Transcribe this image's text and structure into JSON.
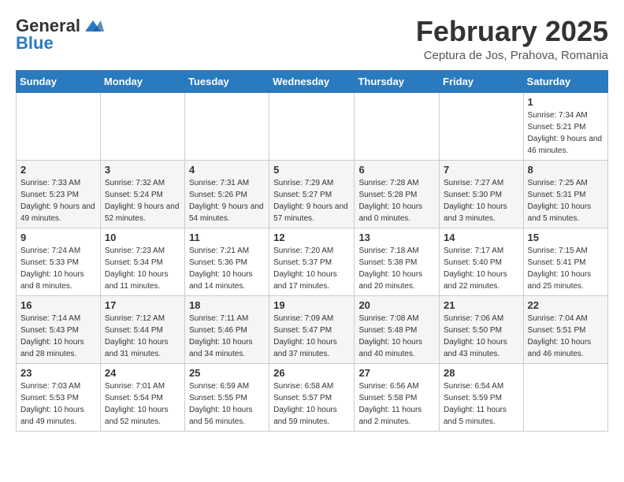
{
  "logo": {
    "general": "General",
    "blue": "Blue"
  },
  "title": "February 2025",
  "location": "Ceptura de Jos, Prahova, Romania",
  "days_of_week": [
    "Sunday",
    "Monday",
    "Tuesday",
    "Wednesday",
    "Thursday",
    "Friday",
    "Saturday"
  ],
  "weeks": [
    [
      {
        "day": "",
        "info": ""
      },
      {
        "day": "",
        "info": ""
      },
      {
        "day": "",
        "info": ""
      },
      {
        "day": "",
        "info": ""
      },
      {
        "day": "",
        "info": ""
      },
      {
        "day": "",
        "info": ""
      },
      {
        "day": "1",
        "info": "Sunrise: 7:34 AM\nSunset: 5:21 PM\nDaylight: 9 hours and 46 minutes."
      }
    ],
    [
      {
        "day": "2",
        "info": "Sunrise: 7:33 AM\nSunset: 5:23 PM\nDaylight: 9 hours and 49 minutes."
      },
      {
        "day": "3",
        "info": "Sunrise: 7:32 AM\nSunset: 5:24 PM\nDaylight: 9 hours and 52 minutes."
      },
      {
        "day": "4",
        "info": "Sunrise: 7:31 AM\nSunset: 5:26 PM\nDaylight: 9 hours and 54 minutes."
      },
      {
        "day": "5",
        "info": "Sunrise: 7:29 AM\nSunset: 5:27 PM\nDaylight: 9 hours and 57 minutes."
      },
      {
        "day": "6",
        "info": "Sunrise: 7:28 AM\nSunset: 5:28 PM\nDaylight: 10 hours and 0 minutes."
      },
      {
        "day": "7",
        "info": "Sunrise: 7:27 AM\nSunset: 5:30 PM\nDaylight: 10 hours and 3 minutes."
      },
      {
        "day": "8",
        "info": "Sunrise: 7:25 AM\nSunset: 5:31 PM\nDaylight: 10 hours and 5 minutes."
      }
    ],
    [
      {
        "day": "9",
        "info": "Sunrise: 7:24 AM\nSunset: 5:33 PM\nDaylight: 10 hours and 8 minutes."
      },
      {
        "day": "10",
        "info": "Sunrise: 7:23 AM\nSunset: 5:34 PM\nDaylight: 10 hours and 11 minutes."
      },
      {
        "day": "11",
        "info": "Sunrise: 7:21 AM\nSunset: 5:36 PM\nDaylight: 10 hours and 14 minutes."
      },
      {
        "day": "12",
        "info": "Sunrise: 7:20 AM\nSunset: 5:37 PM\nDaylight: 10 hours and 17 minutes."
      },
      {
        "day": "13",
        "info": "Sunrise: 7:18 AM\nSunset: 5:38 PM\nDaylight: 10 hours and 20 minutes."
      },
      {
        "day": "14",
        "info": "Sunrise: 7:17 AM\nSunset: 5:40 PM\nDaylight: 10 hours and 22 minutes."
      },
      {
        "day": "15",
        "info": "Sunrise: 7:15 AM\nSunset: 5:41 PM\nDaylight: 10 hours and 25 minutes."
      }
    ],
    [
      {
        "day": "16",
        "info": "Sunrise: 7:14 AM\nSunset: 5:43 PM\nDaylight: 10 hours and 28 minutes."
      },
      {
        "day": "17",
        "info": "Sunrise: 7:12 AM\nSunset: 5:44 PM\nDaylight: 10 hours and 31 minutes."
      },
      {
        "day": "18",
        "info": "Sunrise: 7:11 AM\nSunset: 5:46 PM\nDaylight: 10 hours and 34 minutes."
      },
      {
        "day": "19",
        "info": "Sunrise: 7:09 AM\nSunset: 5:47 PM\nDaylight: 10 hours and 37 minutes."
      },
      {
        "day": "20",
        "info": "Sunrise: 7:08 AM\nSunset: 5:48 PM\nDaylight: 10 hours and 40 minutes."
      },
      {
        "day": "21",
        "info": "Sunrise: 7:06 AM\nSunset: 5:50 PM\nDaylight: 10 hours and 43 minutes."
      },
      {
        "day": "22",
        "info": "Sunrise: 7:04 AM\nSunset: 5:51 PM\nDaylight: 10 hours and 46 minutes."
      }
    ],
    [
      {
        "day": "23",
        "info": "Sunrise: 7:03 AM\nSunset: 5:53 PM\nDaylight: 10 hours and 49 minutes."
      },
      {
        "day": "24",
        "info": "Sunrise: 7:01 AM\nSunset: 5:54 PM\nDaylight: 10 hours and 52 minutes."
      },
      {
        "day": "25",
        "info": "Sunrise: 6:59 AM\nSunset: 5:55 PM\nDaylight: 10 hours and 56 minutes."
      },
      {
        "day": "26",
        "info": "Sunrise: 6:58 AM\nSunset: 5:57 PM\nDaylight: 10 hours and 59 minutes."
      },
      {
        "day": "27",
        "info": "Sunrise: 6:56 AM\nSunset: 5:58 PM\nDaylight: 11 hours and 2 minutes."
      },
      {
        "day": "28",
        "info": "Sunrise: 6:54 AM\nSunset: 5:59 PM\nDaylight: 11 hours and 5 minutes."
      },
      {
        "day": "",
        "info": ""
      }
    ]
  ]
}
